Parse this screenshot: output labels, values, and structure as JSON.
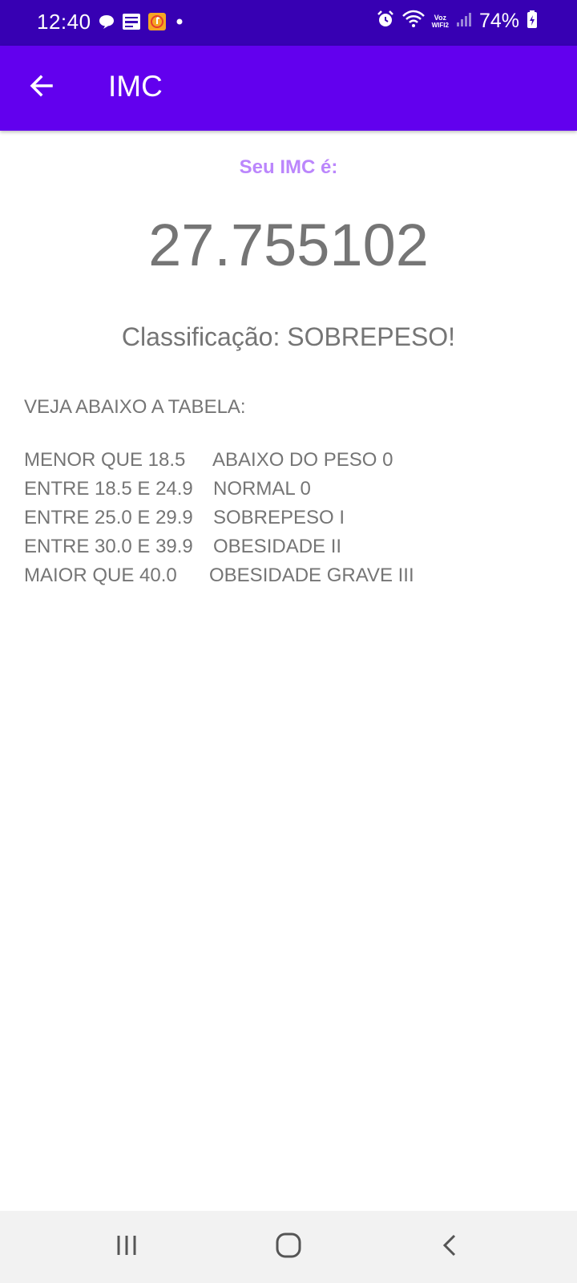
{
  "status_bar": {
    "time": "12:40",
    "battery": "74%",
    "voz": "Voz",
    "wifi2": "WIFI2",
    "left_icons": [
      "chat-bubble-icon",
      "news-app-icon",
      "music-app-icon",
      "dot-icon"
    ],
    "right_icons": [
      "alarm-icon",
      "wifi-icon",
      "signal-icon",
      "battery-icon"
    ]
  },
  "app_bar": {
    "title": "IMC",
    "back_icon": "arrow-left-icon"
  },
  "result": {
    "label": "Seu IMC é:",
    "value": "27.755102",
    "classification": "Classificação: SOBREPESO!"
  },
  "table": {
    "heading": "VEJA ABAIXO A TABELA:",
    "rows": [
      {
        "range": "MENOR QUE 18.5",
        "category": "ABAIXO DO PESO 0"
      },
      {
        "range": "ENTRE 18.5 E 24.9",
        "category": "NORMAL 0"
      },
      {
        "range": "ENTRE 25.0 E 29.9",
        "category": "SOBREPESO I"
      },
      {
        "range": "ENTRE 30.0 E 39.9",
        "category": "OBESIDADE II"
      },
      {
        "range": "MAIOR QUE 40.0",
        "category": "OBESIDADE GRAVE III"
      }
    ]
  },
  "nav_bar": {
    "buttons": [
      "recent-apps-icon",
      "home-icon",
      "back-icon"
    ]
  },
  "colors": {
    "status_bar": "#3700b3",
    "app_bar": "#6200ee",
    "label_accent": "#bb86fc",
    "text_gray": "#757575"
  }
}
